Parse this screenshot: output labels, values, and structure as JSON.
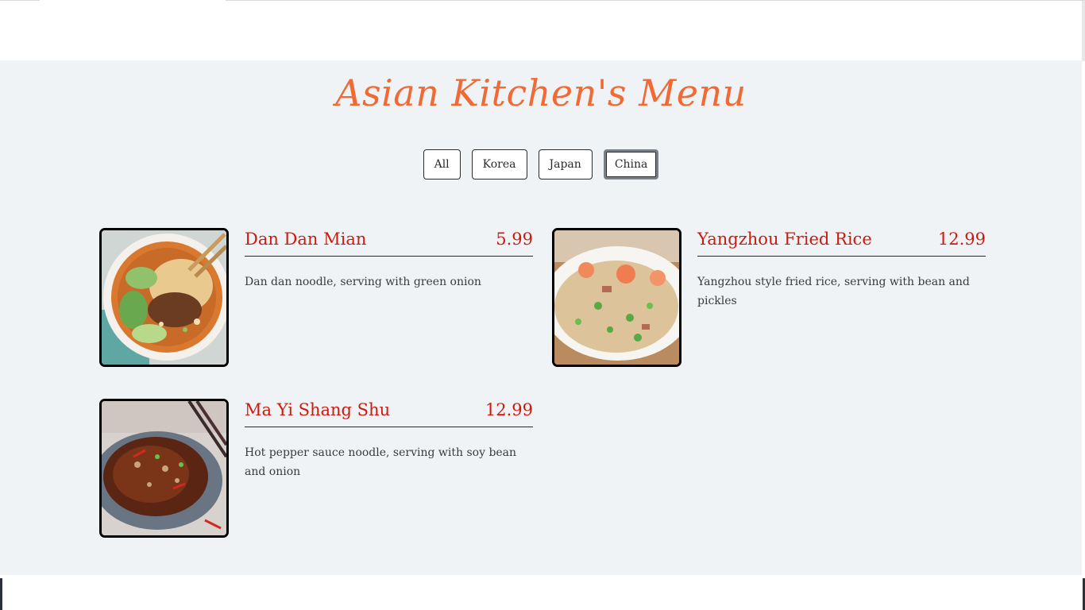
{
  "page": {
    "title": "Asian Kitchen's Menu"
  },
  "filters": [
    {
      "label": "All",
      "active": false
    },
    {
      "label": "Korea",
      "active": false
    },
    {
      "label": "Japan",
      "active": false
    },
    {
      "label": "China",
      "active": true
    }
  ],
  "menu": {
    "items": [
      {
        "name": "Dan Dan Mian",
        "price": "5.99",
        "description": "Dan dan noodle, serving with green onion",
        "image_alt": "dan-dan-mian-photo"
      },
      {
        "name": "Yangzhou Fried Rice",
        "price": "12.99",
        "description": "Yangzhou style fried rice, serving with bean and pickles",
        "image_alt": "yangzhou-fried-rice-photo"
      },
      {
        "name": "Ma Yi Shang Shu",
        "price": "12.99",
        "description": "Hot pepper sauce noodle, serving with soy bean and onion",
        "image_alt": "ma-yi-shang-shu-photo"
      }
    ]
  },
  "colors": {
    "title": "#f06a35",
    "item_text": "#cc1a0e",
    "background": "#f0f3f6"
  }
}
